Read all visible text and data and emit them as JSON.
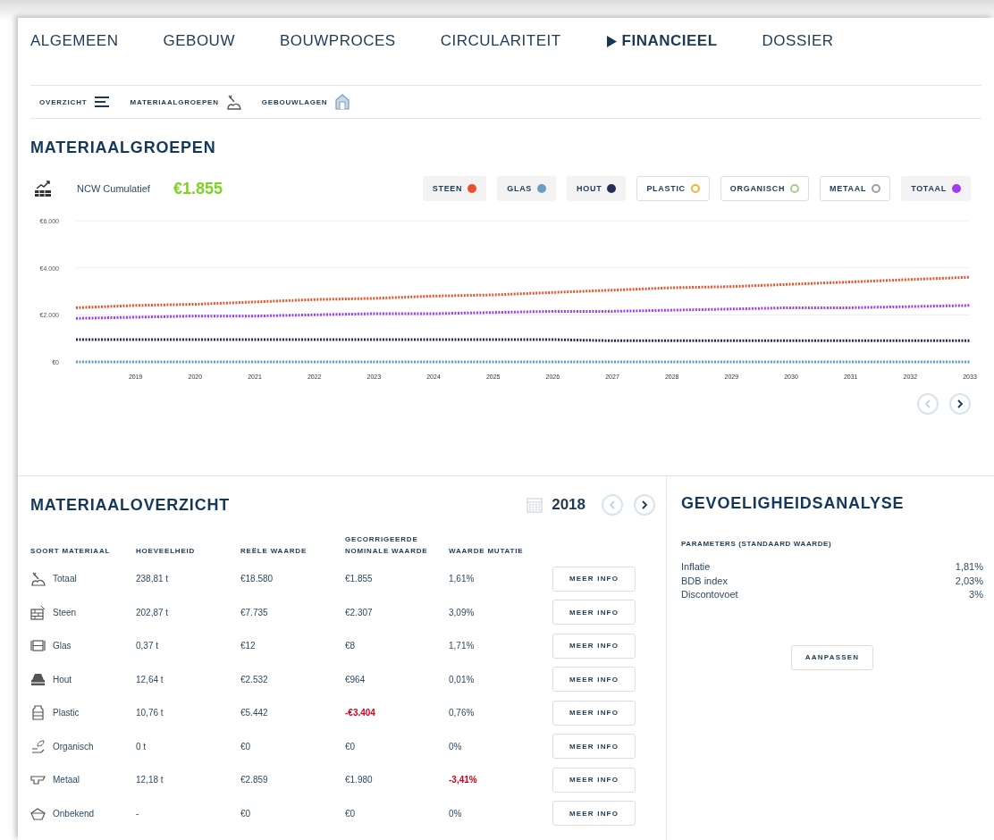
{
  "tabs": [
    {
      "label": "ALGEMEEN",
      "selected": false
    },
    {
      "label": "GEBOUW",
      "selected": false
    },
    {
      "label": "BOUWPROCES",
      "selected": false
    },
    {
      "label": "CIRCULARITEIT",
      "selected": false
    },
    {
      "label": "FINANCIEEL",
      "selected": true
    },
    {
      "label": "DOSSIER",
      "selected": false
    }
  ],
  "subnav": [
    {
      "label": "OVERZICHT",
      "kind": "lines"
    },
    {
      "label": "MATERIAALGROEPEN",
      "kind": "materials"
    },
    {
      "label": "GEBOUWLAGEN",
      "kind": "house"
    }
  ],
  "materiaalgroepen": {
    "title": "MATERIAALGROEPEN",
    "metric_label": "NCW Cumulatief",
    "metric_value": "€1.855",
    "legend": [
      {
        "selected": true
      },
      {
        "selected": true
      },
      {
        "selected": true
      },
      {
        "selected": false
      },
      {
        "selected": false
      },
      {
        "selected": false
      },
      {
        "selected": true
      }
    ],
    "chart_data": {
      "type": "line",
      "x": [
        2018,
        2019,
        2020,
        2021,
        2022,
        2023,
        2024,
        2025,
        2026,
        2027,
        2028,
        2029,
        2030,
        2031,
        2032,
        2033
      ],
      "xlim": [
        2018,
        2033
      ],
      "xticks": [
        2019,
        2020,
        2021,
        2022,
        2023,
        2024,
        2025,
        2026,
        2027,
        2028,
        2029,
        2030,
        2031,
        2032,
        2033
      ],
      "ylim": [
        0,
        6000
      ],
      "yticks": [
        {
          "value": 0,
          "label": "€0"
        },
        {
          "value": 2000,
          "label": "€2.000"
        },
        {
          "value": 4000,
          "label": "€4.000"
        },
        {
          "value": 6000,
          "label": "€6.000"
        }
      ],
      "series": [
        {
          "name": "STEEN",
          "color": "#e8542a",
          "line_style": "dotted",
          "values": [
            2300,
            2400,
            2450,
            2550,
            2650,
            2700,
            2800,
            2850,
            2950,
            3050,
            3150,
            3200,
            3300,
            3400,
            3500,
            3600
          ]
        },
        {
          "name": "GLAS",
          "color": "#6a9ec0",
          "line_style": "dotted",
          "values": [
            0,
            0,
            0,
            0,
            0,
            0,
            0,
            0,
            0,
            0,
            0,
            0,
            0,
            0,
            0,
            0
          ]
        },
        {
          "name": "HOUT",
          "color": "#262e56",
          "line_style": "dotted",
          "values": [
            950,
            950,
            950,
            950,
            950,
            950,
            950,
            950,
            950,
            900,
            900,
            900,
            900,
            900,
            900,
            900
          ]
        },
        {
          "name": "PLASTIC",
          "color": "#f5b335",
          "values": [
            null,
            null,
            null,
            null,
            null,
            null,
            null,
            null,
            null,
            null,
            null,
            null,
            null,
            null,
            null,
            null
          ]
        },
        {
          "name": "ORGANISCH",
          "color": "#a8cc8c",
          "values": [
            null,
            null,
            null,
            null,
            null,
            null,
            null,
            null,
            null,
            null,
            null,
            null,
            null,
            null,
            null,
            null
          ]
        },
        {
          "name": "METAAL",
          "color": "#a0a0a0",
          "values": [
            null,
            null,
            null,
            null,
            null,
            null,
            null,
            null,
            null,
            null,
            null,
            null,
            null,
            null,
            null,
            null
          ]
        },
        {
          "name": "TOTAAL",
          "color": "#a03cf0",
          "line_style": "dotted",
          "values": [
            1850,
            1900,
            1950,
            1950,
            2000,
            2050,
            2050,
            2100,
            2150,
            2150,
            2200,
            2250,
            2300,
            2300,
            2350,
            2400
          ]
        }
      ]
    },
    "pager": {
      "prev_disabled": true,
      "next_disabled": false
    }
  },
  "materiaaloverzicht": {
    "title": "MATERIAALOVERZICHT",
    "year": "2018",
    "pager": {
      "prev_disabled": true,
      "next_disabled": false
    },
    "columns": [
      "SOORT MATERIAAL",
      "HOEVEELHEID",
      "REËLE WAARDE",
      "GECORRIGEERDE NOMINALE WAARDE",
      "WAARDE MUTATIE"
    ],
    "rows": [
      {
        "name": "Totaal",
        "quantity": "238,81 t",
        "real_value": "€18.580",
        "corrected_value": {
          "text": "€1.855",
          "negative": false
        },
        "mutation": {
          "text": "1,61%",
          "negative": false
        },
        "button_label": "MEER INFO"
      },
      {
        "name": "Steen",
        "quantity": "202,87 t",
        "real_value": "€7.735",
        "corrected_value": {
          "text": "€2.307",
          "negative": false
        },
        "mutation": {
          "text": "3,09%",
          "negative": false
        },
        "button_label": "MEER INFO"
      },
      {
        "name": "Glas",
        "quantity": "0,37 t",
        "real_value": "€12",
        "corrected_value": {
          "text": "€8",
          "negative": false
        },
        "mutation": {
          "text": "1,71%",
          "negative": false
        },
        "button_label": "MEER INFO"
      },
      {
        "name": "Hout",
        "quantity": "12,64 t",
        "real_value": "€2.532",
        "corrected_value": {
          "text": "€964",
          "negative": false
        },
        "mutation": {
          "text": "0,01%",
          "negative": false
        },
        "button_label": "MEER INFO"
      },
      {
        "name": "Plastic",
        "quantity": "10,76 t",
        "real_value": "€5.442",
        "corrected_value": {
          "text": "-€3.404",
          "negative": true
        },
        "mutation": {
          "text": "0,76%",
          "negative": false
        },
        "button_label": "MEER INFO"
      },
      {
        "name": "Organisch",
        "quantity": "0 t",
        "real_value": "€0",
        "corrected_value": {
          "text": "€0",
          "negative": false
        },
        "mutation": {
          "text": "0%",
          "negative": false
        },
        "button_label": "MEER INFO"
      },
      {
        "name": "Metaal",
        "quantity": "12,18 t",
        "real_value": "€2.859",
        "corrected_value": {
          "text": "€1.980",
          "negative": false
        },
        "mutation": {
          "text": "-3,41%",
          "negative": true
        },
        "button_label": "MEER INFO"
      },
      {
        "name": "Onbekend",
        "quantity": "-",
        "real_value": "€0",
        "corrected_value": {
          "text": "€0",
          "negative": false
        },
        "mutation": {
          "text": "0%",
          "negative": false
        },
        "button_label": "MEER INFO"
      }
    ]
  },
  "gevoeligheidsanalyse": {
    "title": "GEVOELIGHEIDSANALYSE",
    "subtitle": "PARAMETERS (STANDAARD WAARDE)",
    "parameters": [
      {
        "label": "Inflatie",
        "value": "1,81%"
      },
      {
        "label": "BDB index",
        "value": "2,03%"
      },
      {
        "label": "Discontovoet",
        "value": "3%"
      }
    ],
    "button_label": "AANPASSEN"
  }
}
